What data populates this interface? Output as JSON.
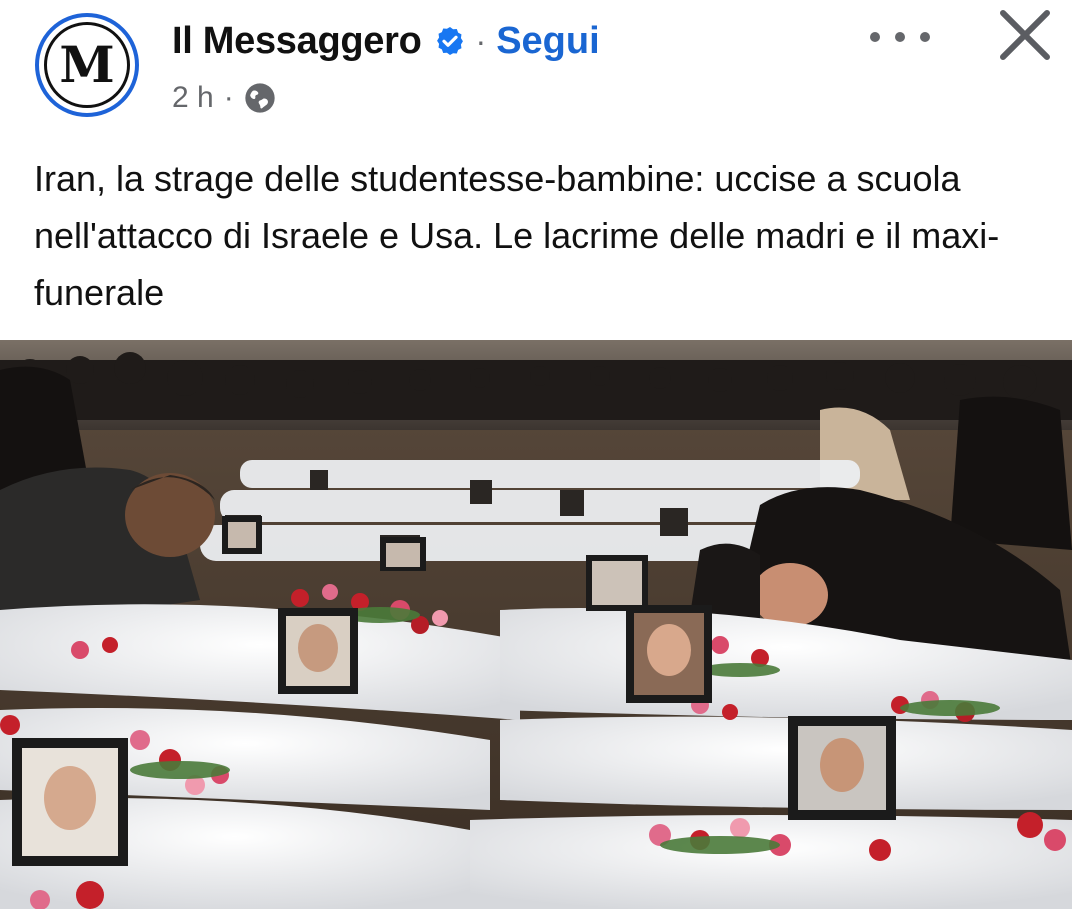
{
  "post": {
    "page_name": "Il Messaggero",
    "avatar_letter": "M",
    "follow_label": "Segui",
    "dot": "·",
    "time": "2 h",
    "audience_icon": "globe-icon",
    "verified_icon": "verified-badge-icon",
    "more_icon": "more-options-icon",
    "close_icon": "close-icon",
    "caption": "Iran, la strage delle studentesse-bambine: uccise a scuola nell'attacco di Israele e Usa. Le lacrime delle madri e il maxi-funerale"
  },
  "colors": {
    "accent": "#1a66d2",
    "avatar_ring": "#1e63d8",
    "meta_gray": "#65676b"
  }
}
